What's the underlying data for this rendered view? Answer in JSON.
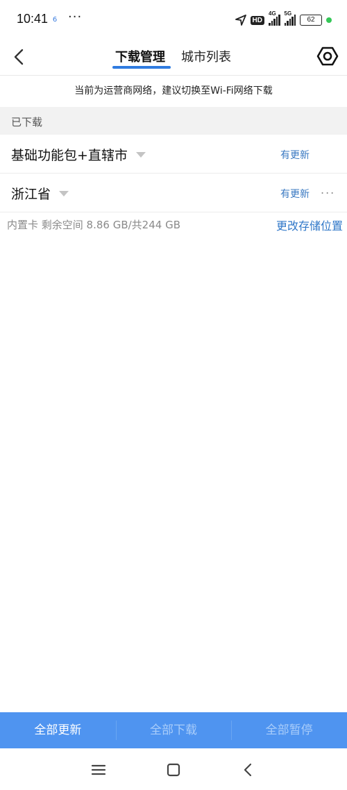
{
  "status_bar": {
    "time": "10:41",
    "app_badge": "6",
    "more": "···",
    "network_4g": "4G",
    "network_5g": "5G",
    "hd_label": "HD",
    "battery": "62"
  },
  "header": {
    "tabs": [
      {
        "label": "下载管理",
        "active": true
      },
      {
        "label": "城市列表",
        "active": false
      }
    ],
    "accent_color": "#2f7be0"
  },
  "notice": "当前为运营商网络，建议切换至Wi-Fi网络下载",
  "section": {
    "title": "已下载"
  },
  "downloads": [
    {
      "name": "基础功能包+直辖市",
      "status": "有更新"
    },
    {
      "name": "浙江省",
      "status": "有更新",
      "more": "..."
    }
  ],
  "storage": {
    "text": "内置卡 剩余空间 8.86 GB/共244 GB",
    "change_link": "更改存储位置"
  },
  "actions": [
    {
      "label": "全部更新",
      "enabled": true
    },
    {
      "label": "全部下载",
      "enabled": false
    },
    {
      "label": "全部暂停",
      "enabled": false
    }
  ],
  "colors": {
    "action_bar": "#4f94f0",
    "link": "#2f77c8",
    "update": "#3a79c2"
  }
}
